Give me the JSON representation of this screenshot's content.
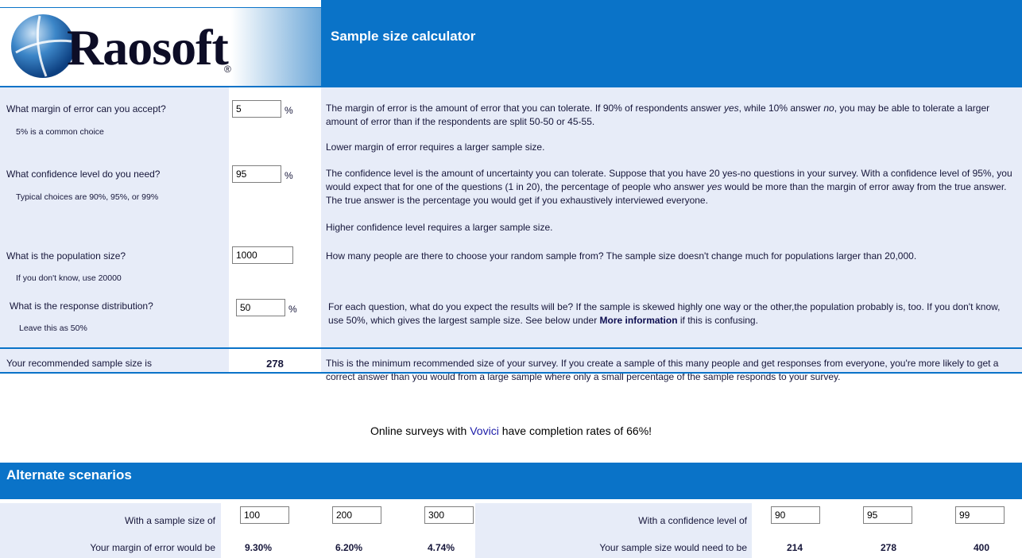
{
  "logo": {
    "text": "Raosoft",
    "reg": "®"
  },
  "header": {
    "title": "Sample size calculator"
  },
  "rows": [
    {
      "question": "What margin of error can you accept?",
      "hint": "5% is a common choice",
      "value": "5",
      "unit": "%",
      "desc_pre": "The margin of error is the amount of error that you can tolerate. If 90% of respondents answer ",
      "desc_em1": "yes",
      "desc_mid": ", while 10% answer ",
      "desc_em2": "no",
      "desc_post": ", you may be able to tolerate a larger amount of error than if the respondents are split 50-50 or 45-55.",
      "desc2": "Lower margin of error requires a larger sample size."
    },
    {
      "question": "What confidence level do you need?",
      "hint": "Typical choices are 90%, 95%, or 99%",
      "value": "95",
      "unit": "%",
      "desc_pre": "The confidence level is the amount of uncertainty you can tolerate. Suppose that you have 20 yes-no questions in your survey. With a confidence level of 95%, you would expect that for one of the questions (1 in 20), the percentage of people who answer ",
      "desc_em1": "yes",
      "desc_post": " would be more than the margin of error away from the true answer. The true answer is the percentage you would get if you exhaustively interviewed everyone.",
      "desc2": "Higher confidence level requires a larger sample size."
    },
    {
      "question": "What is the population size?",
      "hint": "If you don't know, use 20000",
      "value": "1000",
      "desc": "How many people are there to choose your random sample from? The sample size doesn't change much for populations larger than 20,000."
    },
    {
      "question": "What is the response distribution?",
      "hint": "Leave this as 50%",
      "value": "50",
      "unit": "%",
      "desc_pre": "For each question, what do you expect the results will be? If the sample is skewed highly one way or the other,the population probably is, too. If you don't know, use 50%, which gives the largest sample size. See below under ",
      "desc_bold": "More information",
      "desc_post": " if this is confusing."
    }
  ],
  "result": {
    "label": "Your recommended sample size is",
    "value": "278",
    "desc": "This is the minimum recommended size of your survey. If you create a sample of this many people and get responses from everyone, you're more likely to get a correct answer than you would from a large sample where only a small percentage of the sample responds to your survey."
  },
  "promo": {
    "pre": "Online surveys with ",
    "link": "Vovici",
    "post": " have completion rates of 66%!"
  },
  "alternate": {
    "title": "Alternate scenarios",
    "left": {
      "label1": "With a sample size of",
      "label2": "Your margin of error would be",
      "inputs": [
        "100",
        "200",
        "300"
      ],
      "results": [
        "9.30%",
        "6.20%",
        "4.74%"
      ]
    },
    "right": {
      "label1": "With a confidence level of",
      "label2": "Your sample size would need to be",
      "inputs": [
        "90",
        "95",
        "99"
      ],
      "results": [
        "214",
        "278",
        "400"
      ]
    }
  },
  "colors": {
    "blue": "#0a73c8",
    "lavender": "#e7ecf8",
    "link": "#1a1aa8"
  }
}
